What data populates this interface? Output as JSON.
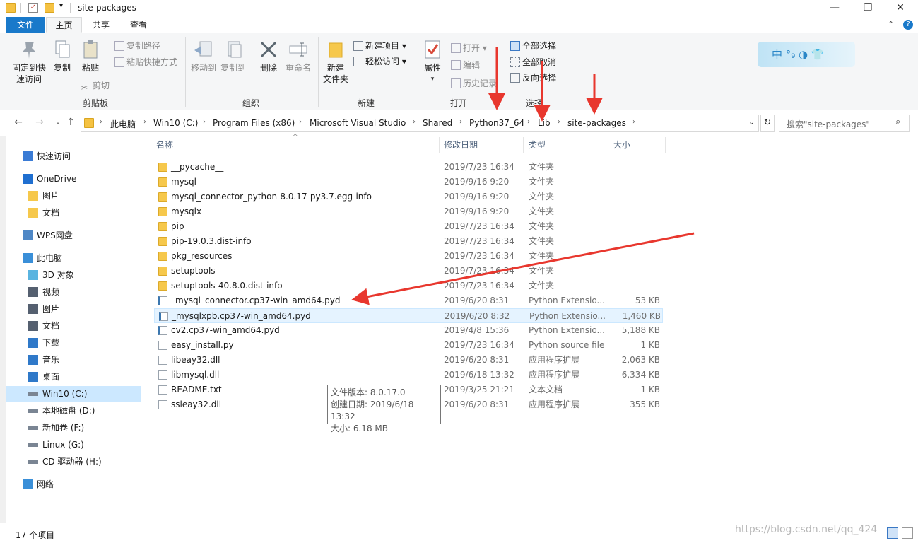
{
  "window": {
    "title": "site-packages",
    "minimize": "—",
    "maximize": "❐",
    "close": "✕"
  },
  "tabs": [
    "文件",
    "主页",
    "共享",
    "查看"
  ],
  "ribbon": {
    "clipboard": {
      "pin_label_line1": "固定到快",
      "pin_label_line2": "速访问",
      "copy": "复制",
      "paste": "粘贴",
      "copy_path": "复制路径",
      "paste_shortcut": "粘贴快捷方式",
      "cut": "剪切",
      "group": "剪贴板"
    },
    "organize": {
      "move_to": "移动到",
      "copy_to": "复制到",
      "delete": "删除",
      "rename": "重命名",
      "group": "组织"
    },
    "new": {
      "new_folder_line1": "新建",
      "new_folder_line2": "文件夹",
      "new_item": "新建项目 ▾",
      "easy_access": "轻松访问 ▾",
      "group": "新建"
    },
    "open": {
      "properties": "属性",
      "open": "打开 ▾",
      "edit": "编辑",
      "history": "历史记录",
      "group": "打开"
    },
    "select": {
      "select_all": "全部选择",
      "select_none": "全部取消",
      "invert": "反向选择",
      "group": "选择"
    },
    "ime_badge": "中 °₉ ◑ 👕"
  },
  "address": {
    "crumbs": [
      "此电脑",
      "Win10 (C:)",
      "Program Files (x86)",
      "Microsoft Visual Studio",
      "Shared",
      "Python37_64",
      "Lib",
      "site-packages"
    ],
    "search_placeholder": "搜索\"site-packages\""
  },
  "sidebar": {
    "items": [
      {
        "label": "快速访问",
        "icon": "star-icon"
      },
      {
        "label": "OneDrive",
        "icon": "cloud-icon"
      },
      {
        "label": "图片",
        "icon": "folder-icon"
      },
      {
        "label": "文档",
        "icon": "folder-icon"
      },
      {
        "label": "WPS网盘",
        "icon": "cloud-outline-icon"
      },
      {
        "label": "此电脑",
        "icon": "computer-icon"
      },
      {
        "label": "3D 对象",
        "icon": "cube-icon"
      },
      {
        "label": "视频",
        "icon": "film-icon"
      },
      {
        "label": "图片",
        "icon": "picture-icon"
      },
      {
        "label": "文档",
        "icon": "document-icon"
      },
      {
        "label": "下载",
        "icon": "download-icon"
      },
      {
        "label": "音乐",
        "icon": "music-icon"
      },
      {
        "label": "桌面",
        "icon": "desktop-icon"
      },
      {
        "label": "Win10 (C:)",
        "icon": "drive-icon"
      },
      {
        "label": "本地磁盘 (D:)",
        "icon": "drive-icon"
      },
      {
        "label": "新加卷 (F:)",
        "icon": "drive-icon"
      },
      {
        "label": "Linux (G:)",
        "icon": "drive-icon"
      },
      {
        "label": "CD 驱动器 (H:)",
        "icon": "cd-drive-icon"
      },
      {
        "label": "网络",
        "icon": "network-icon"
      }
    ]
  },
  "columns": {
    "name": "名称",
    "date": "修改日期",
    "type": "类型",
    "size": "大小"
  },
  "files": [
    {
      "name": "__pycache__",
      "date": "2019/7/23 16:34",
      "type": "文件夹",
      "size": "",
      "kind": "folder"
    },
    {
      "name": "mysql",
      "date": "2019/9/16 9:20",
      "type": "文件夹",
      "size": "",
      "kind": "folder"
    },
    {
      "name": "mysql_connector_python-8.0.17-py3.7.egg-info",
      "date": "2019/9/16 9:20",
      "type": "文件夹",
      "size": "",
      "kind": "folder"
    },
    {
      "name": "mysqlx",
      "date": "2019/9/16 9:20",
      "type": "文件夹",
      "size": "",
      "kind": "folder"
    },
    {
      "name": "pip",
      "date": "2019/7/23 16:34",
      "type": "文件夹",
      "size": "",
      "kind": "folder"
    },
    {
      "name": "pip-19.0.3.dist-info",
      "date": "2019/7/23 16:34",
      "type": "文件夹",
      "size": "",
      "kind": "folder"
    },
    {
      "name": "pkg_resources",
      "date": "2019/7/23 16:34",
      "type": "文件夹",
      "size": "",
      "kind": "folder"
    },
    {
      "name": "setuptools",
      "date": "2019/7/23 16:34",
      "type": "文件夹",
      "size": "",
      "kind": "folder"
    },
    {
      "name": "setuptools-40.8.0.dist-info",
      "date": "2019/7/23 16:34",
      "type": "文件夹",
      "size": "",
      "kind": "folder"
    },
    {
      "name": "_mysql_connector.cp37-win_amd64.pyd",
      "date": "2019/6/20 8:31",
      "type": "Python Extensio...",
      "size": "53 KB",
      "kind": "py"
    },
    {
      "name": "_mysqlxpb.cp37-win_amd64.pyd",
      "date": "2019/6/20 8:32",
      "type": "Python Extensio...",
      "size": "1,460 KB",
      "kind": "py"
    },
    {
      "name": "cv2.cp37-win_amd64.pyd",
      "date": "2019/4/8 15:36",
      "type": "Python Extensio...",
      "size": "5,188 KB",
      "kind": "py"
    },
    {
      "name": "easy_install.py",
      "date": "2019/7/23 16:34",
      "type": "Python source file",
      "size": "1 KB",
      "kind": "file"
    },
    {
      "name": "libeay32.dll",
      "date": "2019/6/20 8:31",
      "type": "应用程序扩展",
      "size": "2,063 KB",
      "kind": "file"
    },
    {
      "name": "libmysql.dll",
      "date": "2019/6/18 13:32",
      "type": "应用程序扩展",
      "size": "6,334 KB",
      "kind": "file"
    },
    {
      "name": "README.txt",
      "date": "2019/3/25 21:21",
      "type": "文本文档",
      "size": "1 KB",
      "kind": "file"
    },
    {
      "name": "ssleay32.dll",
      "date": "2019/6/20 8:31",
      "type": "应用程序扩展",
      "size": "355 KB",
      "kind": "file"
    }
  ],
  "tooltip": {
    "line1": "文件版本: 8.0.17.0",
    "line2": "创建日期: 2019/6/18 13:32",
    "line3": "大小: 6.18 MB"
  },
  "status": {
    "count": "17 个项目",
    "watermark": "https://blog.csdn.net/qq_424"
  },
  "colors": {
    "accent": "#1979ca",
    "arrow": "#e8372e",
    "hover_row": "#e5f3ff",
    "selected": "#cce8ff"
  }
}
